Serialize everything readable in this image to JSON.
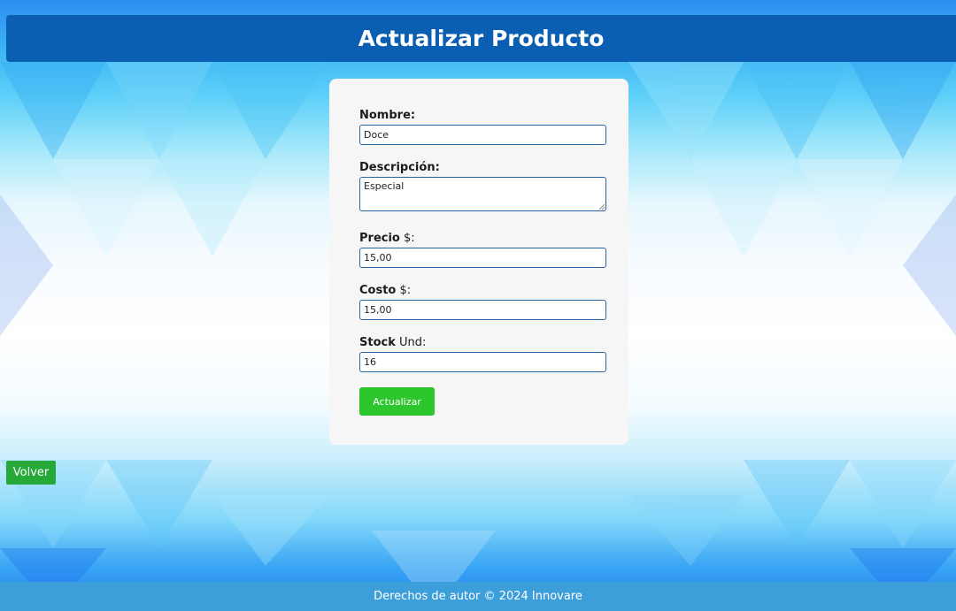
{
  "page": {
    "title": "Actualizar Producto"
  },
  "form": {
    "nombre": {
      "label": "Nombre:",
      "value": "Doce"
    },
    "descripcion": {
      "label": "Descripción:",
      "value": "Especial"
    },
    "precio": {
      "label_bold": "Precio",
      "label_rest": " $:",
      "value": "15,00"
    },
    "costo": {
      "label_bold": "Costo",
      "label_rest": " $:",
      "value": "15,00"
    },
    "stock": {
      "label_bold": "Stock",
      "label_rest": " Und:",
      "value": "16"
    },
    "submit_label": "Actualizar"
  },
  "nav": {
    "back_label": "Volver"
  },
  "footer": {
    "text": "Derechos de autor © 2024 Innovare"
  },
  "colors": {
    "header_bg": "#0b5fb2",
    "submit_bg": "#2dc72d",
    "back_bg": "#27a93a",
    "footer_bg": "#3d9fd9",
    "input_border": "#2466a8"
  }
}
